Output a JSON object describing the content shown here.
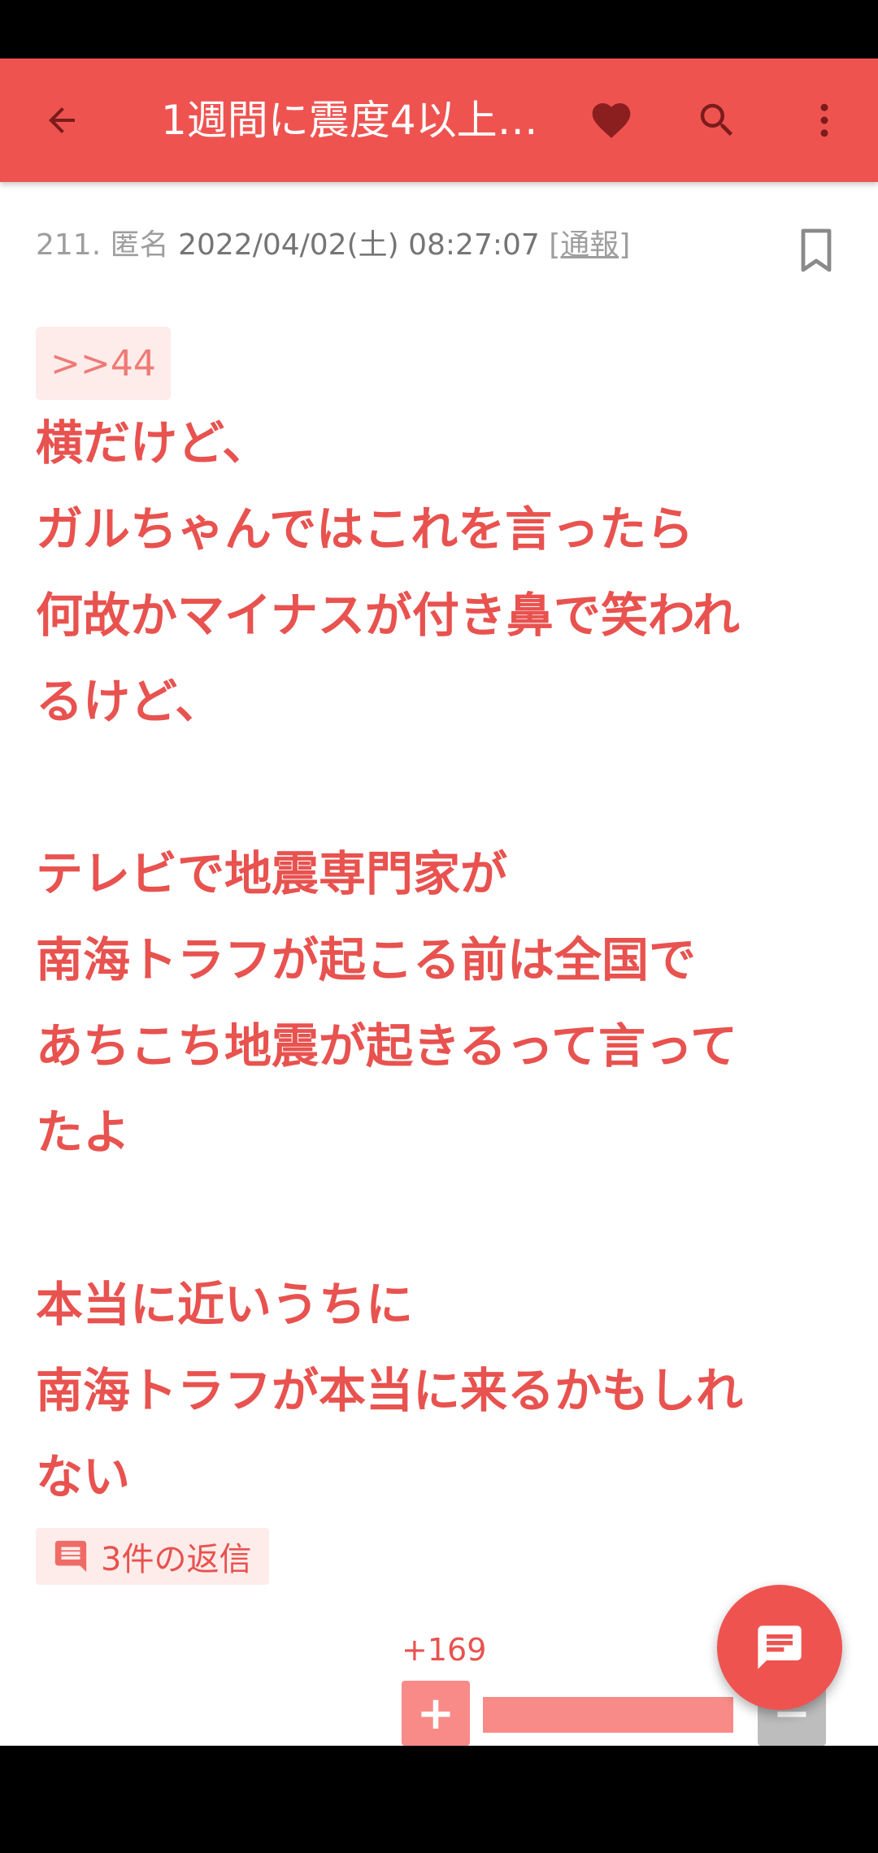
{
  "app_bar": {
    "title": "1週間に震度4以上…"
  },
  "post": {
    "number": "211.",
    "author": "匿名",
    "date": "2022/04/02(土) 08:27:07",
    "report_label": "[通報]",
    "anchor": ">>44",
    "body": "横だけど、\nガルちゃんではこれを言ったら\n何故かマイナスが付き鼻で笑われ\nるけど、\n\nテレビで地震専門家が\n南海トラフが起こる前は全国で\nあちこち地震が起きるって言って\nたよ\n\n本当に近いうちに\n南海トラフが本当に来るかもしれ\nない",
    "replies_label": "3件の返信",
    "vote_count": "+169",
    "plus_label": "+",
    "minus_label": "−"
  },
  "colors": {
    "accent": "#ef5350",
    "heart": "#8b1f1f",
    "text_red": "#e8524f",
    "chip_bg": "#fdecea"
  }
}
